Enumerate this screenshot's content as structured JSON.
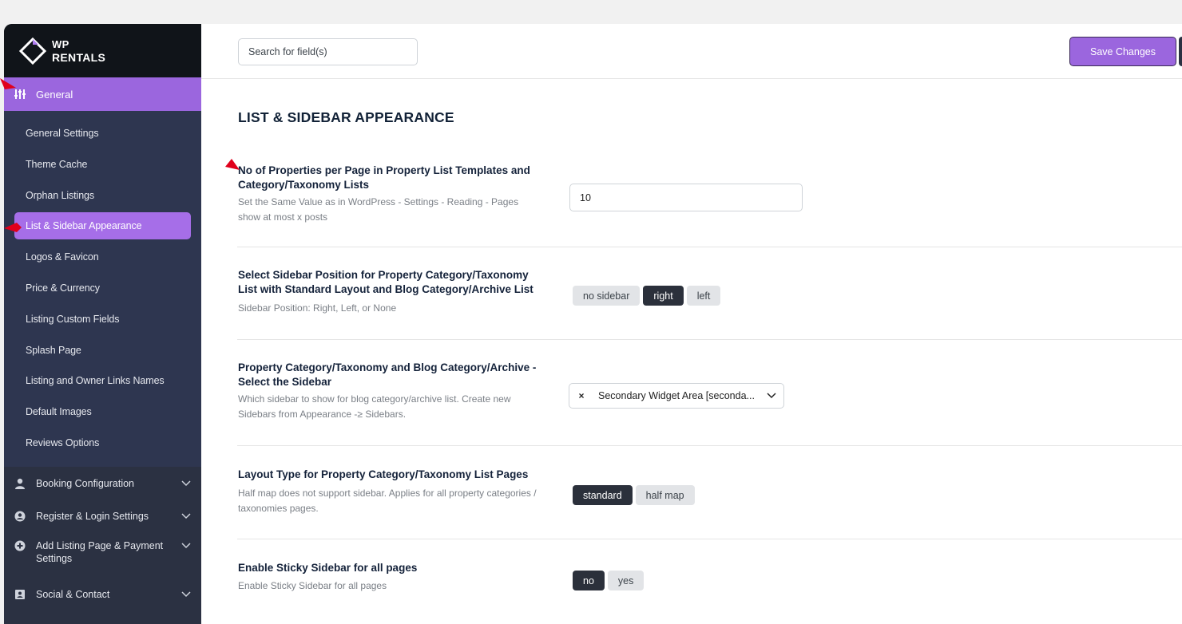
{
  "brand": {
    "line1": "WP",
    "line2": "RENTALS"
  },
  "sidebar": {
    "active_section": "General",
    "sub_items": [
      "General Settings",
      "Theme Cache",
      "Orphan Listings",
      "List & Sidebar Appearance",
      "Logos & Favicon",
      "Price & Currency",
      "Listing Custom Fields",
      "Splash Page",
      "Listing and Owner Links Names",
      "Default Images",
      "Reviews Options"
    ],
    "groups": [
      "Booking Configuration",
      "Register & Login Settings",
      "Add Listing Page & Payment Settings",
      "Social & Contact"
    ]
  },
  "topbar": {
    "search_placeholder": "Search for field(s)",
    "save_label": "Save Changes"
  },
  "page": {
    "title": "LIST & SIDEBAR APPEARANCE",
    "options": [
      {
        "label": "No of Properties per Page in Property List Templates and Category/Taxonomy Lists",
        "desc": "Set the Same Value as in WordPress - Settings - Reading - Pages show at most x posts",
        "value": "10"
      },
      {
        "label": "Select Sidebar Position for Property Category/Taxonomy List with Standard Layout and Blog Category/Archive List",
        "desc": "Sidebar Position: Right, Left, or None",
        "choices": [
          "no sidebar",
          "right",
          "left"
        ],
        "selected": "right"
      },
      {
        "label": "Property Category/Taxonomy and Blog Category/Archive - Select the Sidebar",
        "desc": "Which sidebar to show for blog category/archive list. Create new Sidebars from Appearance -≥ Sidebars.",
        "clear": "×",
        "value": "Secondary Widget Area [seconda..."
      },
      {
        "label": "Layout Type for Property Category/Taxonomy List Pages",
        "desc": "Half map does not support sidebar. Applies for all property categories / taxonomies pages.",
        "choices": [
          "standard",
          "half map"
        ],
        "selected": "standard"
      },
      {
        "label": "Enable Sticky Sidebar for all pages",
        "desc": "Enable Sticky Sidebar for all pages",
        "choices": [
          "no",
          "yes"
        ],
        "selected": "no"
      }
    ]
  },
  "colors": {
    "accent": "#9b66de",
    "sidebar_bg": "#2b3142",
    "dark_pill": "#2b303b",
    "marker": "#e0001b"
  }
}
